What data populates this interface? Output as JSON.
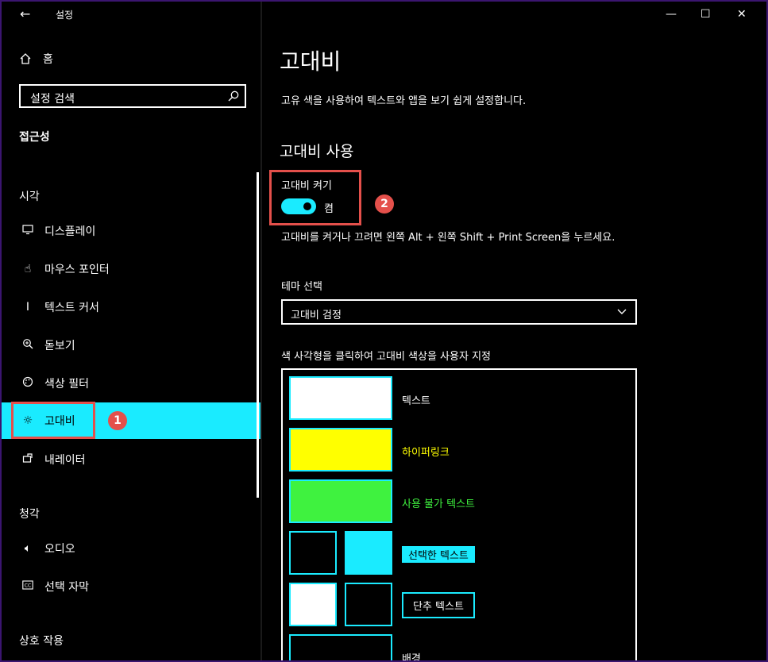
{
  "window": {
    "title": "설정",
    "back_icon": "←",
    "minimize": "—",
    "maximize": "☐",
    "close": "✕"
  },
  "sidebar": {
    "home_label": "홈",
    "search_placeholder": "설정 검색",
    "category": "접근성",
    "groups": [
      {
        "title": "시각",
        "items": [
          {
            "label": "디스플레이",
            "icon": "display-icon"
          },
          {
            "label": "마우스 포인터",
            "icon": "mouse-pointer-icon"
          },
          {
            "label": "텍스트 커서",
            "icon": "text-cursor-icon"
          },
          {
            "label": "돋보기",
            "icon": "magnifier-icon"
          },
          {
            "label": "색상 필터",
            "icon": "palette-icon"
          },
          {
            "label": "고대비",
            "icon": "sun-icon",
            "active": true
          },
          {
            "label": "내레이터",
            "icon": "narrator-icon"
          }
        ]
      },
      {
        "title": "청각",
        "items": [
          {
            "label": "오디오",
            "icon": "speaker-icon"
          },
          {
            "label": "선택 자막",
            "icon": "caption-icon"
          }
        ]
      },
      {
        "title": "상호 작용"
      }
    ]
  },
  "main": {
    "title": "고대비",
    "description": "고유 색을 사용하여 텍스트와 앱을 보기 쉽게 설정합니다.",
    "section_title": "고대비 사용",
    "toggle_label": "고대비 켜기",
    "toggle_state": "켬",
    "hint": "고대비를 켜거나 끄려면 왼쪽 Alt + 왼쪽 Shift + Print Screen을 누르세요.",
    "theme_label": "테마 선택",
    "theme_value": "고대비 검정",
    "swatch_instructions": "색 사각형을 클릭하여 고대비 색상을 사용자 지정",
    "swatches": {
      "text": "텍스트",
      "hyperlink": "하이퍼링크",
      "disabled_text": "사용 불가 텍스트",
      "selected_text": "선택한 텍스트",
      "button_text": "단추 텍스트",
      "background": "배경"
    }
  },
  "annotations": {
    "badge1": "1",
    "badge2": "2"
  },
  "colors": {
    "accent": "#1aebff",
    "hyperlink": "#ffff00",
    "disabled": "#3ff23f",
    "annotation": "#e4504b"
  }
}
